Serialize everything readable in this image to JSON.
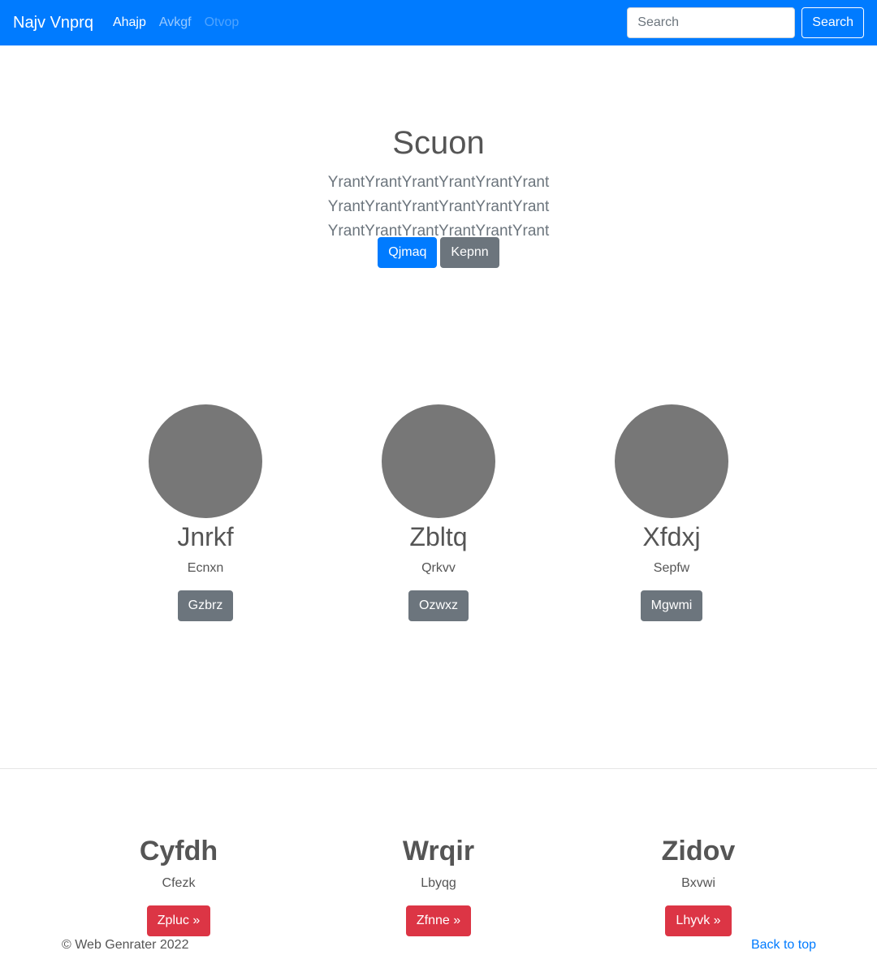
{
  "navbar": {
    "brand": "Najv Vnprq",
    "links": [
      {
        "label": "Ahajp",
        "state": "active"
      },
      {
        "label": "Avkgf",
        "state": "normal"
      },
      {
        "label": "Otvop",
        "state": "disabled"
      }
    ],
    "search_placeholder": "Search",
    "search_button": "Search"
  },
  "hero": {
    "title": "Scuon",
    "lead": "YrantYrantYrantYrantYrantYrant YrantYrantYrantYrantYrantYrant YrantYrantYrantYrantYrantYrant",
    "primary_button": "Qjmaq",
    "secondary_button": "Kepnn"
  },
  "cards": [
    {
      "name": "Jnrkf",
      "subtitle": "Ecnxn",
      "button": "Gzbrz"
    },
    {
      "name": "Zbltq",
      "subtitle": "Qrkvv",
      "button": "Ozwxz"
    },
    {
      "name": "Xfdxj",
      "subtitle": "Sepfw",
      "button": "Mgwmi"
    }
  ],
  "features": [
    {
      "title": "Cyfdh",
      "subtitle": "Cfezk",
      "button": "Zpluc »"
    },
    {
      "title": "Wrqir",
      "subtitle": "Lbyqg",
      "button": "Zfnne »"
    },
    {
      "title": "Zidov",
      "subtitle": "Bxvwi",
      "button": "Lhyvk »"
    }
  ],
  "footer": {
    "copyright": "© Web Genrater 2022",
    "back_to_top": "Back to top"
  },
  "colors": {
    "primary": "#007bff",
    "secondary": "#6c757d",
    "danger": "#dc3545",
    "avatar": "#777777"
  }
}
